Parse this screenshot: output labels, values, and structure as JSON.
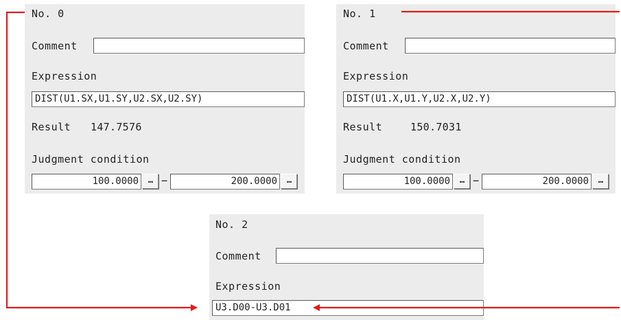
{
  "panels": [
    {
      "title": "No. 0",
      "comment_label": "Comment",
      "comment_value": "",
      "expression_label": "Expression",
      "expression_value": "DIST(U1.SX,U1.SY,U2.SX,U2.SY)",
      "result_label": "Result",
      "result_value": "147.7576",
      "judgment_label": "Judgment condition",
      "judgment_min": "100.0000",
      "judgment_max": "200.0000",
      "dash": "−",
      "dots": "…"
    },
    {
      "title": "No. 1",
      "comment_label": "Comment",
      "comment_value": "",
      "expression_label": "Expression",
      "expression_value": "DIST(U1.X,U1.Y,U2.X,U2.Y)",
      "result_label": "Result",
      "result_value": "150.7031",
      "judgment_label": "Judgment condition",
      "judgment_min": "100.0000",
      "judgment_max": "200.0000",
      "dash": "−",
      "dots": "…"
    },
    {
      "title": "No. 2",
      "comment_label": "Comment",
      "comment_value": "",
      "expression_label": "Expression",
      "expression_value": "U3.D00-U3.D01"
    }
  ],
  "colors": {
    "arrow": "#e31b1b",
    "panel_bg": "#ececec"
  }
}
